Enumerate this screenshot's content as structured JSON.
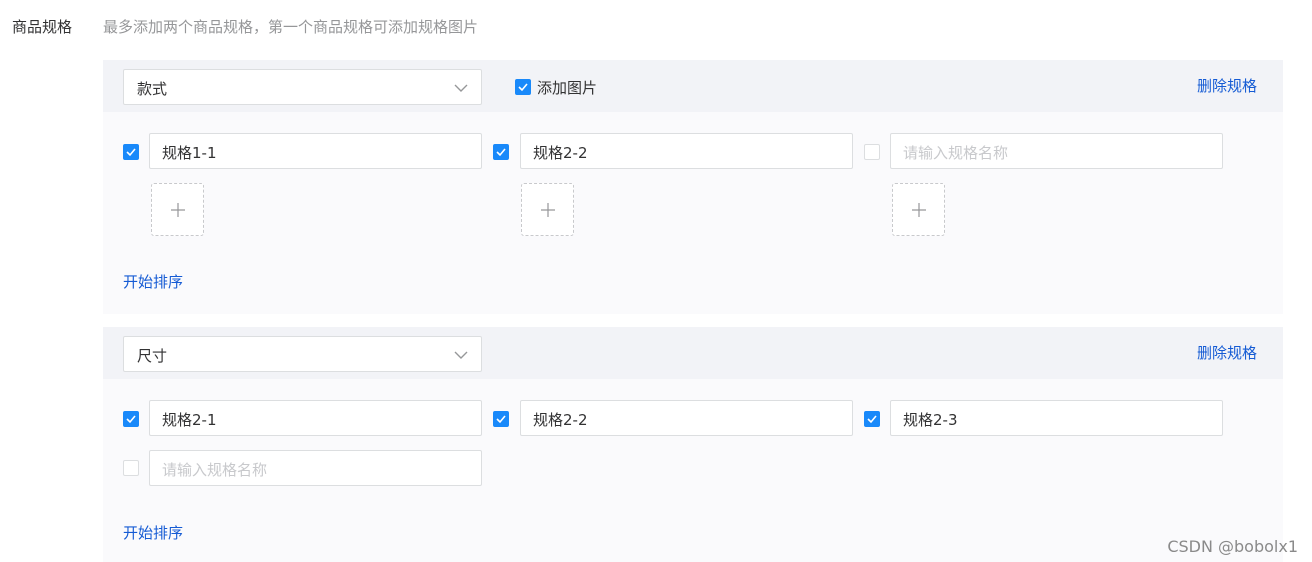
{
  "field": {
    "label": "商品规格",
    "hint": "最多添加两个商品规格，第一个商品规格可添加规格图片"
  },
  "specs": [
    {
      "name": "款式",
      "add_image_label": "添加图片",
      "add_image_checked": true,
      "delete_label": "删除规格",
      "values": [
        {
          "checked": true,
          "value": "规格1-1"
        },
        {
          "checked": true,
          "value": "规格2-2"
        },
        {
          "checked": false,
          "value": "",
          "placeholder": "请输入规格名称"
        }
      ],
      "sort_label": "开始排序"
    },
    {
      "name": "尺寸",
      "delete_label": "删除规格",
      "values": [
        {
          "checked": true,
          "value": "规格2-1"
        },
        {
          "checked": true,
          "value": "规格2-2"
        },
        {
          "checked": true,
          "value": "规格2-3"
        },
        {
          "checked": false,
          "value": "",
          "placeholder": "请输入规格名称"
        }
      ],
      "sort_label": "开始排序"
    }
  ],
  "icons": {
    "select_arrow": "chevron-down-icon",
    "checked": "checkmark-icon",
    "upload": "plus-icon"
  },
  "colors": {
    "primary": "#1989fa",
    "link": "#155bd4",
    "hint": "#969799",
    "placeholder": "#c8c9cc"
  },
  "watermark": "CSDN @bobolx1"
}
